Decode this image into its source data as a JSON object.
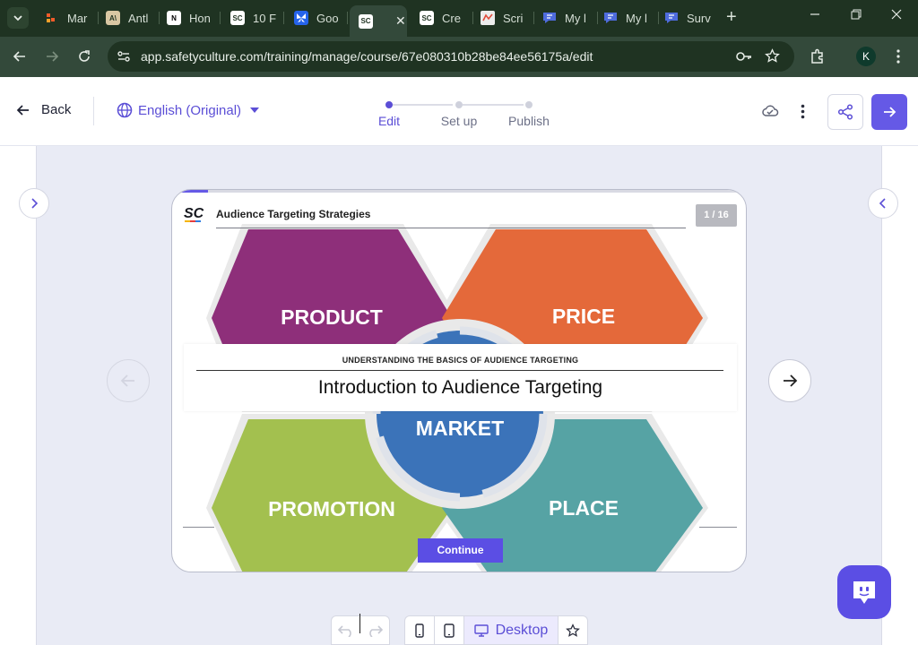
{
  "browser": {
    "tabs": [
      {
        "label": "Mar",
        "icon": "asana-icon",
        "color": "#f06a6a"
      },
      {
        "label": "Antl",
        "icon": "anthropic-icon",
        "color": "#d9c7a3"
      },
      {
        "label": "Hon",
        "icon": "notion-icon",
        "color": "#ffffff"
      },
      {
        "label": "10 F",
        "icon": "safetyculture-icon",
        "color": "#ffffff"
      },
      {
        "label": "Goo",
        "icon": "butterfly-icon",
        "color": "#3b82f6"
      },
      {
        "label": "",
        "icon": "safetyculture-icon",
        "color": "#ffffff",
        "active": true
      },
      {
        "label": "Cre",
        "icon": "safetyculture-icon",
        "color": "#ffffff"
      },
      {
        "label": "Scri",
        "icon": "scribe-icon",
        "color": "#e8e8e8"
      },
      {
        "label": "My l",
        "icon": "chat-bubble-icon",
        "color": "#5b6ee1"
      },
      {
        "label": "My l",
        "icon": "chat-bubble-icon",
        "color": "#5b6ee1"
      },
      {
        "label": "Surv",
        "icon": "chat-bubble-icon",
        "color": "#5b6ee1"
      }
    ],
    "url": "app.safetyculture.com/training/manage/course/67e080310b28be84ee56175a/edit",
    "profile_initial": "K"
  },
  "header": {
    "back_label": "Back",
    "language_label": "English (Original)",
    "steps": [
      "Edit",
      "Set up",
      "Publish"
    ],
    "active_step": 0,
    "accent": "#6559e6"
  },
  "slide": {
    "logo_text": "SC",
    "title": "Audience Targeting Strategies",
    "counter": "1 / 16",
    "progress": 0.0625,
    "diagram": {
      "product": "PRODUCT",
      "price": "PRICE",
      "market": "MARKET",
      "promotion": "PROMOTION",
      "place": "PLACE",
      "colors": {
        "product": "#8e2f7a",
        "price": "#e4693a",
        "promotion": "#a3c04f",
        "place": "#56a3a4",
        "market": "#3b73b9"
      }
    },
    "kicker": "UNDERSTANDING THE BASICS OF AUDIENCE TARGETING",
    "heading": "Introduction to Audience Targeting",
    "continue_label": "Continue"
  },
  "toolbar": {
    "device_active_label": "Desktop"
  }
}
